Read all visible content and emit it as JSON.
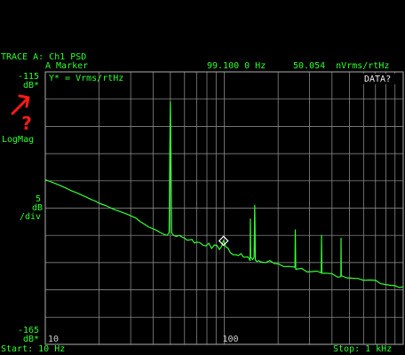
{
  "header": {
    "trace_title": "TRACE A: Ch1 PSD",
    "marker_label": "A Marker",
    "marker_freq": "99.100 0 Hz",
    "marker_value": "50.054  nVrms/rtHz",
    "units_caption": "Y* = Vrms/rtHz",
    "data_flag": "DATA?"
  },
  "left_axis": {
    "top_value": "-115",
    "top_unit": "dB*",
    "scale_value": "5",
    "scale_unit": "dB",
    "scale_per": "/div",
    "bottom_value": "-165",
    "bottom_unit": "dB*",
    "mode": "LogMag",
    "question_mark": "?"
  },
  "footer": {
    "start": "Start: 10 Hz",
    "stop": "Stop: 1 kHz"
  },
  "colors": {
    "trace": "#33ff33",
    "grid": "#9a9a9a",
    "text": "#2bff2b",
    "annotation": "#ff1a1a",
    "marker": "#ffffff"
  },
  "chart_data": {
    "type": "line",
    "title": "TRACE A: Ch1 PSD",
    "ylabel": "dB*",
    "xscale": "log",
    "xlim": [
      10,
      1000
    ],
    "ylim": [
      -165,
      -115
    ],
    "grid": true,
    "x_tick_labels": [
      "10",
      "100"
    ],
    "marker": {
      "x": 99.1,
      "y": -146
    },
    "series": [
      {
        "points": [
          [
            10,
            -134.8
          ],
          [
            11,
            -135.3
          ],
          [
            12,
            -135.8
          ],
          [
            13,
            -136.3
          ],
          [
            14,
            -136.8
          ],
          [
            15,
            -137.2
          ],
          [
            16,
            -137.6
          ],
          [
            17,
            -138.0
          ],
          [
            18,
            -138.4
          ],
          [
            19,
            -138.7
          ],
          [
            20,
            -139.1
          ],
          [
            22,
            -139.6
          ],
          [
            24,
            -140.2
          ],
          [
            26,
            -140.6
          ],
          [
            28,
            -141.0
          ],
          [
            30,
            -141.4
          ],
          [
            32,
            -141.8
          ],
          [
            34,
            -142.5
          ],
          [
            36,
            -143.0
          ],
          [
            38,
            -143.5
          ],
          [
            40,
            -143.8
          ],
          [
            42,
            -144.1
          ],
          [
            44,
            -144.5
          ],
          [
            46,
            -144.8
          ],
          [
            48,
            -145.0
          ],
          [
            49.2,
            -144.5
          ],
          [
            49.6,
            -131.0
          ],
          [
            50.0,
            -120.5
          ],
          [
            50.4,
            -131.0
          ],
          [
            50.8,
            -144.5
          ],
          [
            52,
            -145.0
          ],
          [
            54,
            -145.2
          ],
          [
            56,
            -145.0
          ],
          [
            58,
            -145.3
          ],
          [
            60,
            -145.5
          ],
          [
            62,
            -145.8
          ],
          [
            64,
            -146.0
          ],
          [
            66,
            -145.7
          ],
          [
            68,
            -146.0
          ],
          [
            70,
            -146.1
          ],
          [
            73,
            -146.3
          ],
          [
            76,
            -146.5
          ],
          [
            79,
            -146.6
          ],
          [
            82,
            -146.8
          ],
          [
            85,
            -147.0
          ],
          [
            88,
            -147.0
          ],
          [
            91,
            -147.1
          ],
          [
            94,
            -147.2
          ],
          [
            97,
            -147.3
          ],
          [
            99.1,
            -146.0
          ],
          [
            102,
            -147.5
          ],
          [
            105,
            -147.7
          ],
          [
            108,
            -148.0
          ],
          [
            112,
            -148.2
          ],
          [
            116,
            -148.3
          ],
          [
            120,
            -148.5
          ],
          [
            124,
            -148.7
          ],
          [
            128,
            -148.9
          ],
          [
            132,
            -149.0
          ],
          [
            136,
            -149.2
          ],
          [
            139.4,
            -149.3
          ],
          [
            140.0,
            -142.0
          ],
          [
            140.6,
            -149.3
          ],
          [
            144,
            -149.2
          ],
          [
            146.8,
            -149.3
          ],
          [
            147.4,
            -144.0
          ],
          [
            148.0,
            -139.5
          ],
          [
            148.6,
            -144.0
          ],
          [
            149.2,
            -149.3
          ],
          [
            152,
            -149.5
          ],
          [
            156,
            -149.4
          ],
          [
            160,
            -149.6
          ],
          [
            170,
            -149.8
          ],
          [
            180,
            -150.0
          ],
          [
            190,
            -150.3
          ],
          [
            200,
            -150.5
          ],
          [
            215,
            -150.6
          ],
          [
            230,
            -150.8
          ],
          [
            248.2,
            -151.0
          ],
          [
            249.6,
            -144.0
          ],
          [
            251.0,
            -151.0
          ],
          [
            270,
            -151.2
          ],
          [
            290,
            -151.4
          ],
          [
            310,
            -151.6
          ],
          [
            330,
            -151.8
          ],
          [
            348.2,
            -151.9
          ],
          [
            349.6,
            -145.0
          ],
          [
            351.0,
            -151.9
          ],
          [
            370,
            -152.0
          ],
          [
            400,
            -152.2
          ],
          [
            430,
            -152.4
          ],
          [
            448.2,
            -152.5
          ],
          [
            449.6,
            -145.5
          ],
          [
            451.0,
            -152.5
          ],
          [
            480,
            -152.6
          ],
          [
            520,
            -152.8
          ],
          [
            560,
            -153.0
          ],
          [
            600,
            -153.2
          ],
          [
            650,
            -153.4
          ],
          [
            700,
            -153.6
          ],
          [
            750,
            -153.8
          ],
          [
            800,
            -154.0
          ],
          [
            850,
            -154.2
          ],
          [
            900,
            -154.4
          ],
          [
            950,
            -154.6
          ],
          [
            1000,
            -154.8
          ]
        ]
      }
    ]
  }
}
